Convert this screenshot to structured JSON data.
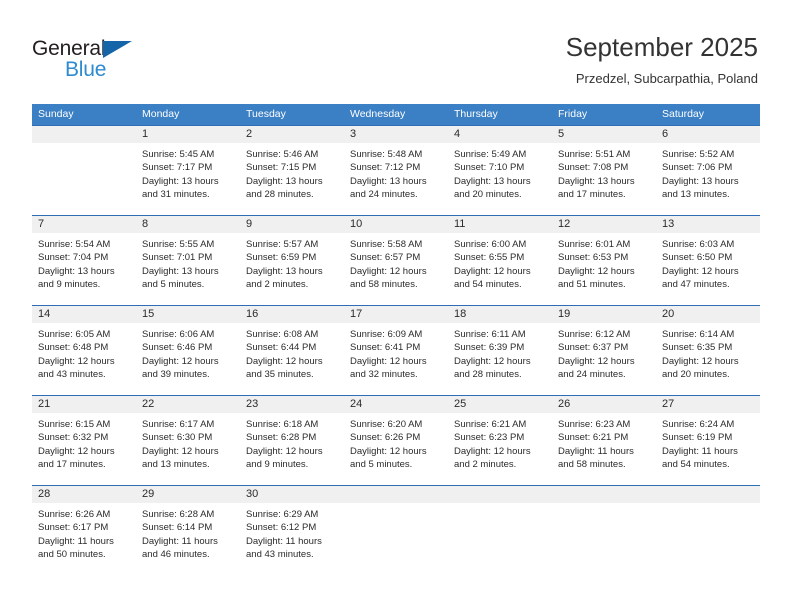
{
  "brand": {
    "name_part1": "General",
    "name_part2": "Blue",
    "accent_color": "#2e8bd0",
    "logo_triangle_color": "#1565a8"
  },
  "header": {
    "title": "September 2025",
    "subtitle": "Przedzel, Subcarpathia, Poland"
  },
  "calendar": {
    "header_bg": "#3b7fc4",
    "day_band_bg": "#f0f0f0",
    "weekday_headers": [
      "Sunday",
      "Monday",
      "Tuesday",
      "Wednesday",
      "Thursday",
      "Friday",
      "Saturday"
    ],
    "weeks": [
      [
        {
          "day": "",
          "sunrise": "",
          "sunset": "",
          "daylight_line1": "",
          "daylight_line2": "",
          "empty": true
        },
        {
          "day": "1",
          "sunrise": "Sunrise: 5:45 AM",
          "sunset": "Sunset: 7:17 PM",
          "daylight_line1": "Daylight: 13 hours",
          "daylight_line2": "and 31 minutes."
        },
        {
          "day": "2",
          "sunrise": "Sunrise: 5:46 AM",
          "sunset": "Sunset: 7:15 PM",
          "daylight_line1": "Daylight: 13 hours",
          "daylight_line2": "and 28 minutes."
        },
        {
          "day": "3",
          "sunrise": "Sunrise: 5:48 AM",
          "sunset": "Sunset: 7:12 PM",
          "daylight_line1": "Daylight: 13 hours",
          "daylight_line2": "and 24 minutes."
        },
        {
          "day": "4",
          "sunrise": "Sunrise: 5:49 AM",
          "sunset": "Sunset: 7:10 PM",
          "daylight_line1": "Daylight: 13 hours",
          "daylight_line2": "and 20 minutes."
        },
        {
          "day": "5",
          "sunrise": "Sunrise: 5:51 AM",
          "sunset": "Sunset: 7:08 PM",
          "daylight_line1": "Daylight: 13 hours",
          "daylight_line2": "and 17 minutes."
        },
        {
          "day": "6",
          "sunrise": "Sunrise: 5:52 AM",
          "sunset": "Sunset: 7:06 PM",
          "daylight_line1": "Daylight: 13 hours",
          "daylight_line2": "and 13 minutes."
        }
      ],
      [
        {
          "day": "7",
          "sunrise": "Sunrise: 5:54 AM",
          "sunset": "Sunset: 7:04 PM",
          "daylight_line1": "Daylight: 13 hours",
          "daylight_line2": "and 9 minutes."
        },
        {
          "day": "8",
          "sunrise": "Sunrise: 5:55 AM",
          "sunset": "Sunset: 7:01 PM",
          "daylight_line1": "Daylight: 13 hours",
          "daylight_line2": "and 5 minutes."
        },
        {
          "day": "9",
          "sunrise": "Sunrise: 5:57 AM",
          "sunset": "Sunset: 6:59 PM",
          "daylight_line1": "Daylight: 13 hours",
          "daylight_line2": "and 2 minutes."
        },
        {
          "day": "10",
          "sunrise": "Sunrise: 5:58 AM",
          "sunset": "Sunset: 6:57 PM",
          "daylight_line1": "Daylight: 12 hours",
          "daylight_line2": "and 58 minutes."
        },
        {
          "day": "11",
          "sunrise": "Sunrise: 6:00 AM",
          "sunset": "Sunset: 6:55 PM",
          "daylight_line1": "Daylight: 12 hours",
          "daylight_line2": "and 54 minutes."
        },
        {
          "day": "12",
          "sunrise": "Sunrise: 6:01 AM",
          "sunset": "Sunset: 6:53 PM",
          "daylight_line1": "Daylight: 12 hours",
          "daylight_line2": "and 51 minutes."
        },
        {
          "day": "13",
          "sunrise": "Sunrise: 6:03 AM",
          "sunset": "Sunset: 6:50 PM",
          "daylight_line1": "Daylight: 12 hours",
          "daylight_line2": "and 47 minutes."
        }
      ],
      [
        {
          "day": "14",
          "sunrise": "Sunrise: 6:05 AM",
          "sunset": "Sunset: 6:48 PM",
          "daylight_line1": "Daylight: 12 hours",
          "daylight_line2": "and 43 minutes."
        },
        {
          "day": "15",
          "sunrise": "Sunrise: 6:06 AM",
          "sunset": "Sunset: 6:46 PM",
          "daylight_line1": "Daylight: 12 hours",
          "daylight_line2": "and 39 minutes."
        },
        {
          "day": "16",
          "sunrise": "Sunrise: 6:08 AM",
          "sunset": "Sunset: 6:44 PM",
          "daylight_line1": "Daylight: 12 hours",
          "daylight_line2": "and 35 minutes."
        },
        {
          "day": "17",
          "sunrise": "Sunrise: 6:09 AM",
          "sunset": "Sunset: 6:41 PM",
          "daylight_line1": "Daylight: 12 hours",
          "daylight_line2": "and 32 minutes."
        },
        {
          "day": "18",
          "sunrise": "Sunrise: 6:11 AM",
          "sunset": "Sunset: 6:39 PM",
          "daylight_line1": "Daylight: 12 hours",
          "daylight_line2": "and 28 minutes."
        },
        {
          "day": "19",
          "sunrise": "Sunrise: 6:12 AM",
          "sunset": "Sunset: 6:37 PM",
          "daylight_line1": "Daylight: 12 hours",
          "daylight_line2": "and 24 minutes."
        },
        {
          "day": "20",
          "sunrise": "Sunrise: 6:14 AM",
          "sunset": "Sunset: 6:35 PM",
          "daylight_line1": "Daylight: 12 hours",
          "daylight_line2": "and 20 minutes."
        }
      ],
      [
        {
          "day": "21",
          "sunrise": "Sunrise: 6:15 AM",
          "sunset": "Sunset: 6:32 PM",
          "daylight_line1": "Daylight: 12 hours",
          "daylight_line2": "and 17 minutes."
        },
        {
          "day": "22",
          "sunrise": "Sunrise: 6:17 AM",
          "sunset": "Sunset: 6:30 PM",
          "daylight_line1": "Daylight: 12 hours",
          "daylight_line2": "and 13 minutes."
        },
        {
          "day": "23",
          "sunrise": "Sunrise: 6:18 AM",
          "sunset": "Sunset: 6:28 PM",
          "daylight_line1": "Daylight: 12 hours",
          "daylight_line2": "and 9 minutes."
        },
        {
          "day": "24",
          "sunrise": "Sunrise: 6:20 AM",
          "sunset": "Sunset: 6:26 PM",
          "daylight_line1": "Daylight: 12 hours",
          "daylight_line2": "and 5 minutes."
        },
        {
          "day": "25",
          "sunrise": "Sunrise: 6:21 AM",
          "sunset": "Sunset: 6:23 PM",
          "daylight_line1": "Daylight: 12 hours",
          "daylight_line2": "and 2 minutes."
        },
        {
          "day": "26",
          "sunrise": "Sunrise: 6:23 AM",
          "sunset": "Sunset: 6:21 PM",
          "daylight_line1": "Daylight: 11 hours",
          "daylight_line2": "and 58 minutes."
        },
        {
          "day": "27",
          "sunrise": "Sunrise: 6:24 AM",
          "sunset": "Sunset: 6:19 PM",
          "daylight_line1": "Daylight: 11 hours",
          "daylight_line2": "and 54 minutes."
        }
      ],
      [
        {
          "day": "28",
          "sunrise": "Sunrise: 6:26 AM",
          "sunset": "Sunset: 6:17 PM",
          "daylight_line1": "Daylight: 11 hours",
          "daylight_line2": "and 50 minutes."
        },
        {
          "day": "29",
          "sunrise": "Sunrise: 6:28 AM",
          "sunset": "Sunset: 6:14 PM",
          "daylight_line1": "Daylight: 11 hours",
          "daylight_line2": "and 46 minutes."
        },
        {
          "day": "30",
          "sunrise": "Sunrise: 6:29 AM",
          "sunset": "Sunset: 6:12 PM",
          "daylight_line1": "Daylight: 11 hours",
          "daylight_line2": "and 43 minutes."
        },
        {
          "day": "",
          "sunrise": "",
          "sunset": "",
          "daylight_line1": "",
          "daylight_line2": "",
          "empty": true
        },
        {
          "day": "",
          "sunrise": "",
          "sunset": "",
          "daylight_line1": "",
          "daylight_line2": "",
          "empty": true
        },
        {
          "day": "",
          "sunrise": "",
          "sunset": "",
          "daylight_line1": "",
          "daylight_line2": "",
          "empty": true
        },
        {
          "day": "",
          "sunrise": "",
          "sunset": "",
          "daylight_line1": "",
          "daylight_line2": "",
          "empty": true
        }
      ]
    ]
  }
}
